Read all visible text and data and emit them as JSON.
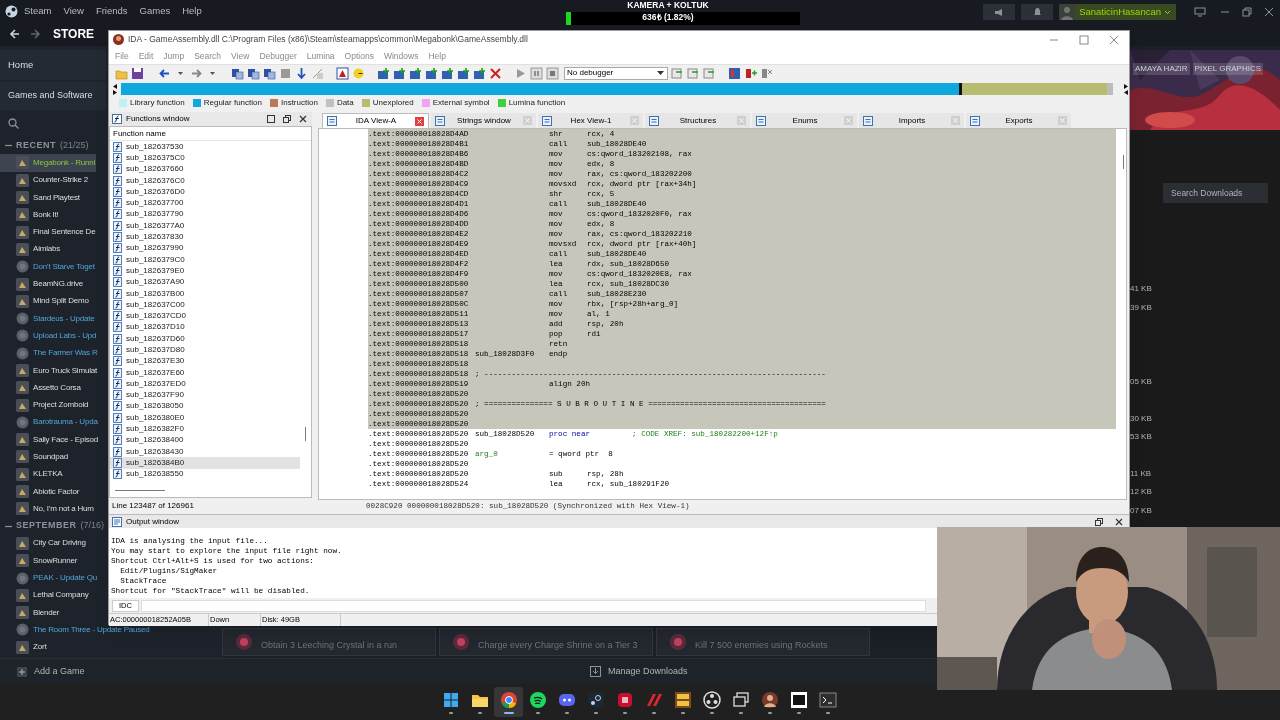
{
  "stream_overlay": {
    "title": "KAMERA + KOLTUK",
    "amount": "636₺ (1.82%)",
    "level": 0.02
  },
  "steam": {
    "menu": [
      "Steam",
      "View",
      "Friends",
      "Games",
      "Help"
    ],
    "nav": [
      "STORE"
    ],
    "user": "SanaticinHasancan",
    "sidebar": {
      "home": "Home",
      "section": "Games and Software",
      "groups": [
        {
          "title": "RECENT",
          "count": "(21/25)",
          "expanded": true,
          "games": [
            {
              "name": "Megabonk - Runni",
              "kind": "running",
              "selected": true
            },
            {
              "name": "Counter-Strike 2",
              "kind": "installed",
              "selected": false
            },
            {
              "name": "Sand Playtest",
              "kind": "installed",
              "selected": false
            },
            {
              "name": "Bonk It!",
              "kind": "installed",
              "selected": false
            },
            {
              "name": "Final Sentence De",
              "kind": "installed",
              "selected": false
            },
            {
              "name": "Aimlabs",
              "kind": "installed",
              "selected": false
            },
            {
              "name": "Don't Starve Toget",
              "kind": "update",
              "selected": false
            },
            {
              "name": "BeamNG.drive",
              "kind": "installed",
              "selected": false
            },
            {
              "name": "Mind Split Demo",
              "kind": "installed",
              "selected": false
            },
            {
              "name": "Stardeus - Update",
              "kind": "update",
              "selected": false
            },
            {
              "name": "Upload Labs - Upd",
              "kind": "update",
              "selected": false
            },
            {
              "name": "The Farmer Was R",
              "kind": "update",
              "selected": false
            },
            {
              "name": "Euro Truck Simulat",
              "kind": "installed",
              "selected": false
            },
            {
              "name": "Assetto Corsa",
              "kind": "installed",
              "selected": false
            },
            {
              "name": "Project Zomboid",
              "kind": "installed",
              "selected": false
            },
            {
              "name": "Barotrauma - Upda",
              "kind": "update",
              "selected": false
            },
            {
              "name": "Sally Face - Episod",
              "kind": "installed",
              "selected": false
            },
            {
              "name": "Soundpad",
              "kind": "installed",
              "selected": false
            },
            {
              "name": "KLETKA",
              "kind": "installed",
              "selected": false
            },
            {
              "name": "Abiotic Factor",
              "kind": "installed",
              "selected": false
            },
            {
              "name": "No, I'm not a Hum",
              "kind": "installed",
              "selected": false
            }
          ]
        },
        {
          "title": "SEPTEMBER",
          "count": "(7/16)",
          "expanded": true,
          "games": [
            {
              "name": "City Car Driving",
              "kind": "installed",
              "selected": false
            },
            {
              "name": "SnowRunner",
              "kind": "installed",
              "selected": false
            },
            {
              "name": "PEAK - Update Qu",
              "kind": "update",
              "selected": false
            },
            {
              "name": "Lethal Company",
              "kind": "installed",
              "selected": false
            },
            {
              "name": "Blender",
              "kind": "installed",
              "selected": false
            },
            {
              "name": "The Room Three - Update Paused",
              "kind": "update",
              "selected": false
            },
            {
              "name": "Zort",
              "kind": "installed",
              "selected": false
            }
          ]
        }
      ]
    },
    "store_tags": [
      "AMAYA HAZIR",
      "PIXEL GRAPHICS"
    ],
    "downloads": {
      "search_placeholder": "Search Downloads",
      "size_groups": [
        [
          "41 KB",
          "39 KB"
        ],
        [
          "05 KB"
        ],
        [
          "30 KB",
          "53 KB"
        ],
        [
          "11 KB",
          "12 KB",
          "07 KB"
        ]
      ]
    },
    "achievements": [
      "Obtain 3 Leeching Crystal in a run",
      "Charge every Charge Shrine on a Tier 3",
      "Kill 7 500 enemies using Rockets"
    ],
    "bottom_bar": {
      "add_game": "Add a Game",
      "downloads": "Manage Downloads"
    }
  },
  "ida": {
    "title": "IDA - GameAssembly.dll C:\\Program Files (x86)\\Steam\\steamapps\\common\\Megabonk\\GameAssembly.dll",
    "menu": [
      "File",
      "Edit",
      "Jump",
      "Search",
      "View",
      "Debugger",
      "Lumina",
      "Options",
      "Windows",
      "Help"
    ],
    "debugger": "No debugger",
    "legend": [
      {
        "label": "Library function",
        "color": "#c0f0f8"
      },
      {
        "label": "Regular function",
        "color": "#10a8e0"
      },
      {
        "label": "Instruction",
        "color": "#b87a5a"
      },
      {
        "label": "Data",
        "color": "#c0c0c0"
      },
      {
        "label": "Unexplored",
        "color": "#b8bc70"
      },
      {
        "label": "External symbol",
        "color": "#f4a0f4"
      },
      {
        "label": "Lumina function",
        "color": "#40d040"
      }
    ],
    "functions_window": {
      "title": "Functions window",
      "column": "Function name",
      "status": "Line 123487 of 126961",
      "items": [
        {
          "name": "sub_182637530",
          "selected": false
        },
        {
          "name": "sub_1826375C0",
          "selected": false
        },
        {
          "name": "sub_182637660",
          "selected": false
        },
        {
          "name": "sub_1826376C0",
          "selected": false
        },
        {
          "name": "sub_1826376D0",
          "selected": false
        },
        {
          "name": "sub_182637700",
          "selected": false
        },
        {
          "name": "sub_182637790",
          "selected": false
        },
        {
          "name": "sub_1826377A0",
          "selected": false
        },
        {
          "name": "sub_182637830",
          "selected": false
        },
        {
          "name": "sub_182637990",
          "selected": false
        },
        {
          "name": "sub_1826379C0",
          "selected": false
        },
        {
          "name": "sub_1826379E0",
          "selected": false
        },
        {
          "name": "sub_182637A90",
          "selected": false
        },
        {
          "name": "sub_182637B00",
          "selected": false
        },
        {
          "name": "sub_182637C00",
          "selected": false
        },
        {
          "name": "sub_182637CD0",
          "selected": false
        },
        {
          "name": "sub_182637D10",
          "selected": false
        },
        {
          "name": "sub_182637D60",
          "selected": false
        },
        {
          "name": "sub_182637D80",
          "selected": false
        },
        {
          "name": "sub_182637E30",
          "selected": false
        },
        {
          "name": "sub_182637E60",
          "selected": false
        },
        {
          "name": "sub_182637ED0",
          "selected": false
        },
        {
          "name": "sub_182637F90",
          "selected": false
        },
        {
          "name": "sub_182638050",
          "selected": false
        },
        {
          "name": "sub_1826380E0",
          "selected": false
        },
        {
          "name": "sub_1826382F0",
          "selected": false
        },
        {
          "name": "sub_182638400",
          "selected": false
        },
        {
          "name": "sub_182638430",
          "selected": false
        },
        {
          "name": "sub_1826384B0",
          "selected": true
        },
        {
          "name": "sub_182638550",
          "selected": false
        }
      ]
    },
    "tabs": [
      {
        "label": "IDA View-A",
        "selected": true
      },
      {
        "label": "Strings window",
        "selected": false
      },
      {
        "label": "Hex View-1",
        "selected": false
      },
      {
        "label": "Structures",
        "selected": false
      },
      {
        "label": "Enums",
        "selected": false
      },
      {
        "label": "Imports",
        "selected": false
      },
      {
        "label": "Exports",
        "selected": false
      }
    ],
    "listing": [
      {
        "addr": ".text:000000018028D4AD",
        "mnem": "shr",
        "ops": "rcx, 4",
        "selected": true
      },
      {
        "addr": ".text:000000018028D4B1",
        "mnem": "call",
        "ops": "sub_18028DE40",
        "selected": true
      },
      {
        "addr": ".text:000000018028D4B6",
        "mnem": "mov",
        "ops": "cs:qword_183202108, rax",
        "selected": true
      },
      {
        "addr": ".text:000000018028D4BD",
        "mnem": "mov",
        "ops": "edx, 8",
        "selected": true
      },
      {
        "addr": ".text:000000018028D4C2",
        "mnem": "mov",
        "ops": "rax, cs:qword_183202200",
        "selected": true
      },
      {
        "addr": ".text:000000018028D4C9",
        "mnem": "movsxd",
        "ops": "rcx, dword ptr [rax+34h]",
        "selected": true
      },
      {
        "addr": ".text:000000018028D4CD",
        "mnem": "shr",
        "ops": "rcx, 5",
        "selected": true
      },
      {
        "addr": ".text:000000018028D4D1",
        "mnem": "call",
        "ops": "sub_18028DE40",
        "selected": true
      },
      {
        "addr": ".text:000000018028D4D6",
        "mnem": "mov",
        "ops": "cs:qword_1832020F0, rax",
        "selected": true
      },
      {
        "addr": ".text:000000018028D4DD",
        "mnem": "mov",
        "ops": "edx, 8",
        "selected": true
      },
      {
        "addr": ".text:000000018028D4E2",
        "mnem": "mov",
        "ops": "rax, cs:qword_183202210",
        "selected": true
      },
      {
        "addr": ".text:000000018028D4E9",
        "mnem": "movsxd",
        "ops": "rcx, dword ptr [rax+40h]",
        "selected": true
      },
      {
        "addr": ".text:000000018028D4ED",
        "mnem": "call",
        "ops": "sub_18028DE40",
        "selected": true
      },
      {
        "addr": ".text:000000018028D4F2",
        "mnem": "lea",
        "ops": "rdx, sub_18028D650",
        "selected": true
      },
      {
        "addr": ".text:000000018028D4F9",
        "mnem": "mov",
        "ops": "cs:qword_1832020E8, rax",
        "selected": true
      },
      {
        "addr": ".text:000000018028D500",
        "mnem": "lea",
        "ops": "rcx, sub_18028DC30",
        "selected": true
      },
      {
        "addr": ".text:000000018028D507",
        "mnem": "call",
        "ops": "sub_18028E230",
        "selected": true
      },
      {
        "addr": ".text:000000018028D50C",
        "mnem": "mov",
        "ops": "rbx, [rsp+28h+arg_0]",
        "selected": true
      },
      {
        "addr": ".text:000000018028D511",
        "mnem": "mov",
        "ops": "al, 1",
        "selected": true
      },
      {
        "addr": ".text:000000018028D513",
        "mnem": "add",
        "ops": "rsp, 20h",
        "selected": true
      },
      {
        "addr": ".text:000000018028D517",
        "mnem": "pop",
        "ops": "rdi",
        "selected": true
      },
      {
        "addr": ".text:000000018028D518",
        "mnem": "retn",
        "selected": true
      },
      {
        "addr": ".text:000000018028D518",
        "label": "sub_18028D3F0",
        "mnem": "endp",
        "selected": true
      },
      {
        "addr": ".text:000000018028D518",
        "selected": true
      },
      {
        "addr": ".text:000000018028D518",
        "note": "; ---------------------------------------------------------------------------",
        "selected": true
      },
      {
        "addr": ".text:000000018028D519",
        "mnem": "align 20h",
        "selected": true
      },
      {
        "addr": ".text:000000018028D520",
        "selected": true
      },
      {
        "addr": ".text:000000018028D520",
        "note": "; =============== S U B R O U T I N E =======================================",
        "selected": true
      },
      {
        "addr": ".text:000000018028D520",
        "selected": true
      },
      {
        "addr": ".text:000000018028D520",
        "selected": true
      },
      {
        "addr": ".text:000000018028D520",
        "label": "sub_18028D520",
        "mnem": "proc near",
        "comment": "; CODE XREF: sub_180282200+12F↑p",
        "selected": false
      },
      {
        "addr": ".text:000000018028D520",
        "selected": false
      },
      {
        "addr": ".text:000000018028D520",
        "label": "arg_0",
        "mnem": "= qword ptr  8",
        "selected": false
      },
      {
        "addr": ".text:000000018028D520",
        "selected": false
      },
      {
        "addr": ".text:000000018028D520",
        "mnem": "sub",
        "ops": "rsp, 28h",
        "selected": false
      },
      {
        "addr": ".text:000000018028D524",
        "mnem": "lea",
        "ops": "rcx, sub_180291F20",
        "selected": false
      }
    ],
    "listing_status": "0028C920 000000018028D520: sub_18028D520 (Synchronized with Hex View-1)",
    "output": {
      "title": "Output window",
      "lines": [
        "IDA is analysing the input file...",
        "You may start to explore the input file right now.",
        "Shortcut Ctrl+Alt+S is used for two actions:",
        "  Edit/Plugins/SigMaker",
        "  StackTrace",
        "Shortcut for \"StackTrace\" will be disabled."
      ],
      "input_label": "IDC"
    },
    "status_bar": [
      "AC:000000018252A05B",
      "Down",
      "Disk: 49GB"
    ]
  },
  "taskbar": [
    {
      "kind": "start",
      "selected": false
    },
    {
      "kind": "folder",
      "selected": false
    },
    {
      "kind": "browser",
      "selected": true
    },
    {
      "kind": "music",
      "selected": false
    },
    {
      "kind": "chat",
      "selected": false
    },
    {
      "kind": "steam",
      "selected": false
    },
    {
      "kind": "red",
      "selected": false
    },
    {
      "kind": "stripes",
      "selected": false
    },
    {
      "kind": "game",
      "selected": false
    },
    {
      "kind": "recorder",
      "selected": false
    },
    {
      "kind": "windows",
      "selected": false
    },
    {
      "kind": "avatar",
      "selected": false
    },
    {
      "kind": "archive",
      "selected": false
    },
    {
      "kind": "terminal",
      "selected": false
    }
  ]
}
